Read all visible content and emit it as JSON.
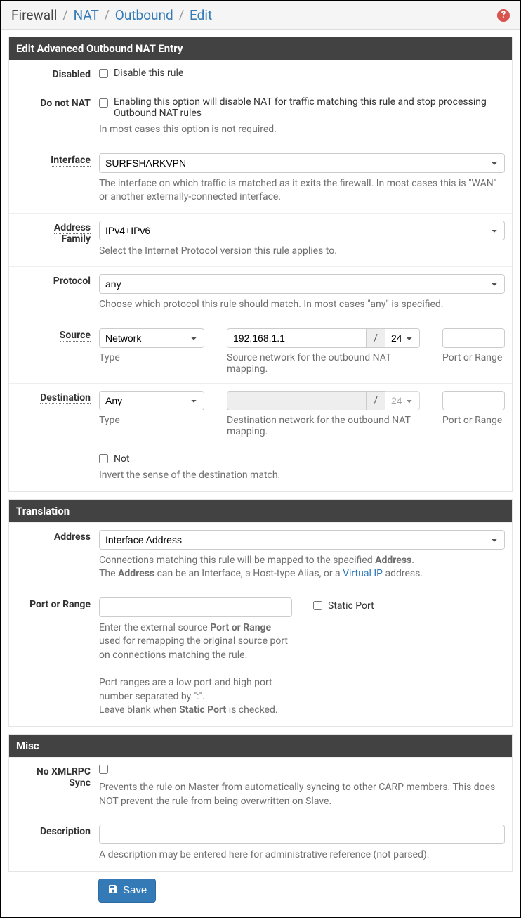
{
  "breadcrumb": {
    "root": "Firewall",
    "nat": "NAT",
    "outbound": "Outbound",
    "edit": "Edit"
  },
  "panel1": {
    "title": "Edit Advanced Outbound NAT Entry",
    "disabled": {
      "label": "Disabled",
      "checkbox": "Disable this rule"
    },
    "donotnat": {
      "label": "Do not NAT",
      "checkbox": "Enabling this option will disable NAT for traffic matching this rule and stop processing Outbound NAT rules",
      "help": "In most cases this option is not required."
    },
    "interface": {
      "label": "Interface",
      "value": "SURFSHARKVPN",
      "help": "The interface on which traffic is matched as it exits the firewall. In most cases this is \"WAN\" or another externally-connected interface."
    },
    "addrfamily": {
      "label1": "Address",
      "label2": "Family",
      "value": "IPv4+IPv6",
      "help": "Select the Internet Protocol version this rule applies to."
    },
    "protocol": {
      "label": "Protocol",
      "value": "any",
      "help": "Choose which protocol this rule should match. In most cases \"any\" is specified."
    },
    "source": {
      "label": "Source",
      "type": "Network",
      "ip": "192.168.1.1",
      "mask": "24",
      "port": "",
      "sub_type": "Type",
      "sub_net": "Source network for the outbound NAT mapping.",
      "sub_port": "Port or Range"
    },
    "destination": {
      "label": "Destination",
      "type": "Any",
      "ip": "",
      "mask": "24",
      "port": "",
      "sub_type": "Type",
      "sub_net": "Destination network for the outbound NAT mapping.",
      "sub_port": "Port or Range",
      "not_label": "Not",
      "not_help": "Invert the sense of the destination match."
    }
  },
  "panel2": {
    "title": "Translation",
    "address": {
      "label": "Address",
      "value": "Interface Address",
      "help1": "Connections matching this rule will be mapped to the specified ",
      "help1b": "Address",
      "help1c": ".",
      "help2a": "The ",
      "help2b": "Address",
      "help2c": " can be an Interface, a Host-type Alias, or a ",
      "help2d": "Virtual IP",
      "help2e": " address."
    },
    "port": {
      "label": "Port or Range",
      "value": "",
      "static_label": "Static Port",
      "help_l1a": "Enter the external source ",
      "help_l1b": "Port or Range",
      "help_l2": "used for remapping the original source port",
      "help_l3": "on connections matching the rule.",
      "help_l4": "Port ranges are a low port and high port",
      "help_l5": "number separated by \":\".",
      "help_l6a": "Leave blank when ",
      "help_l6b": "Static Port",
      "help_l6c": " is checked."
    }
  },
  "panel3": {
    "title": "Misc",
    "noxml": {
      "label1": "No XMLRPC",
      "label2": "Sync",
      "help": "Prevents the rule on Master from automatically syncing to other CARP members. This does NOT prevent the rule from being overwritten on Slave."
    },
    "description": {
      "label": "Description",
      "value": "",
      "help": "A description may be entered here for administrative reference (not parsed)."
    }
  },
  "save_button": "Save"
}
